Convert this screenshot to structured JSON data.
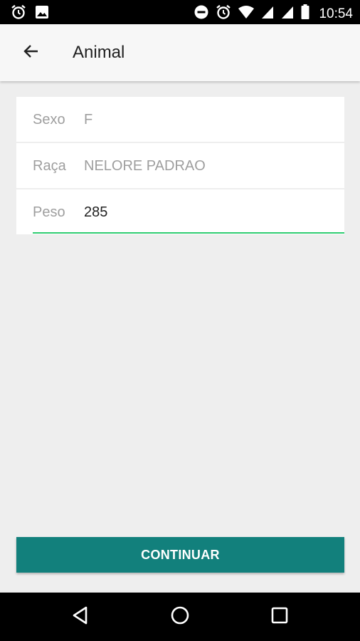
{
  "status_bar": {
    "time": "10:54",
    "left_icons": [
      "alarm-icon",
      "image-icon"
    ],
    "right_icons": [
      "do-not-disturb-icon",
      "alarm-icon",
      "wifi-icon",
      "signal-icon",
      "signal-icon",
      "battery-icon"
    ]
  },
  "app_bar": {
    "title": "Animal",
    "back_icon": "arrow-back-icon"
  },
  "form": {
    "sexo": {
      "label": "Sexo",
      "value": "F"
    },
    "raca": {
      "label": "Raça",
      "value": "NELORE PADRAO"
    },
    "peso": {
      "label": "Peso",
      "value": "285"
    }
  },
  "actions": {
    "continue_label": "CONTINUAR"
  },
  "colors": {
    "accent": "#12807c",
    "focus_underline": "#2ecc71",
    "background": "#eeeeee"
  },
  "nav_bar": {
    "buttons": [
      "back-triangle-icon",
      "home-circle-icon",
      "recents-square-icon"
    ]
  }
}
